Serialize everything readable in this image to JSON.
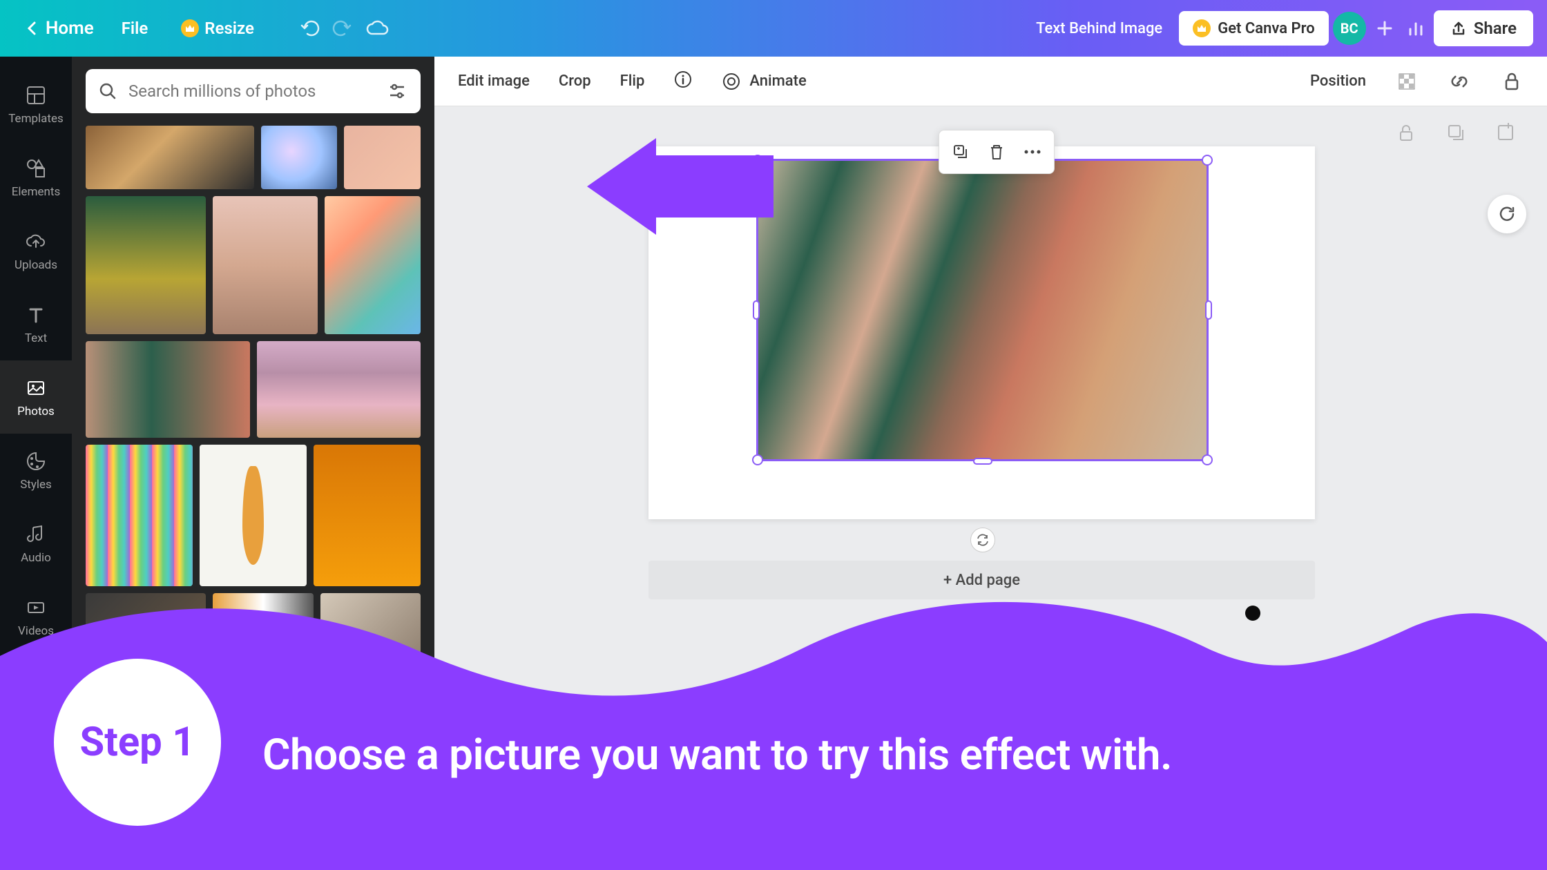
{
  "topbar": {
    "home": "Home",
    "file": "File",
    "resize": "Resize",
    "doc_title": "Text Behind Image",
    "pro_label": "Get Canva Pro",
    "avatar_initials": "BC",
    "share": "Share"
  },
  "side_nav": [
    {
      "key": "templates",
      "label": "Templates"
    },
    {
      "key": "elements",
      "label": "Elements"
    },
    {
      "key": "uploads",
      "label": "Uploads"
    },
    {
      "key": "text",
      "label": "Text"
    },
    {
      "key": "photos",
      "label": "Photos",
      "active": true
    },
    {
      "key": "styles",
      "label": "Styles"
    },
    {
      "key": "audio",
      "label": "Audio"
    },
    {
      "key": "videos",
      "label": "Videos"
    }
  ],
  "search": {
    "placeholder": "Search millions of photos"
  },
  "image_toolbar": {
    "edit_image": "Edit image",
    "crop": "Crop",
    "flip": "Flip",
    "animate": "Animate",
    "position": "Position"
  },
  "canvas": {
    "add_page": "+ Add page"
  },
  "tutorial": {
    "step_label": "Step 1",
    "instruction": "Choose a picture you want to try this effect with."
  }
}
